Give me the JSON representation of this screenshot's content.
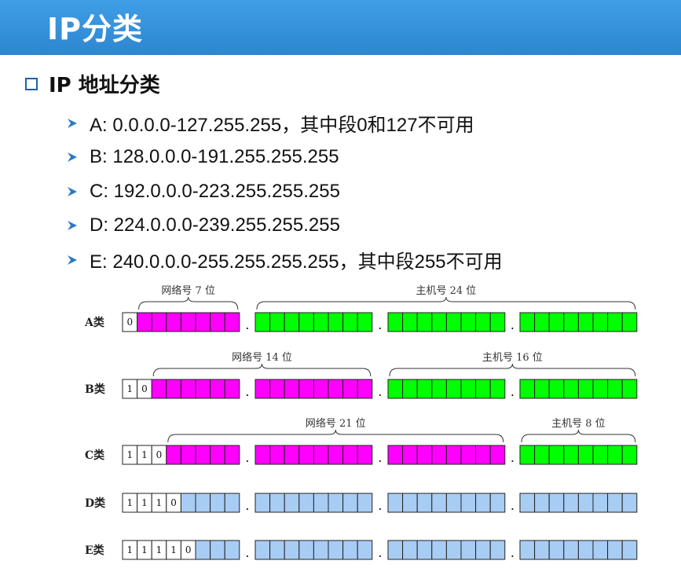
{
  "title": "IP分类",
  "section": {
    "heading": "IP 地址分类"
  },
  "bullets": [
    "A: 0.0.0.0-127.255.255，其中段0和127不可用",
    "B: 128.0.0.0-191.255.255.255",
    "C: 192.0.0.0-223.255.255.255",
    "D: 224.0.0.0-239.255.255.255",
    "E: 240.0.0.0-255.255.255.255，其中段255不可用"
  ],
  "colors": {
    "title_bar": "#3390dd",
    "network": "#ff00ff",
    "host": "#00ff00",
    "class_de": "#a8cdf5",
    "prefix": "#ffffff",
    "bullet_arrow": "#2a78c8"
  },
  "icons": {
    "heading": "checkbox-icon",
    "bullet": "arrow-icon"
  },
  "diagram": {
    "dot": ".",
    "classes": [
      {
        "label": "A类",
        "prefix": [
          "0"
        ],
        "network_bits": 8,
        "braces": [
          {
            "text": "网络号 7 位",
            "from_bit": 1,
            "to_bit": 8
          },
          {
            "text": "主机号 24 位",
            "from_bit": 8,
            "to_bit": 32
          }
        ]
      },
      {
        "label": "B类",
        "prefix": [
          "1",
          "0"
        ],
        "network_bits": 16,
        "braces": [
          {
            "text": "网络号 14 位",
            "from_bit": 2,
            "to_bit": 16
          },
          {
            "text": "主机号 16 位",
            "from_bit": 16,
            "to_bit": 32
          }
        ]
      },
      {
        "label": "C类",
        "prefix": [
          "1",
          "1",
          "0"
        ],
        "network_bits": 24,
        "braces": [
          {
            "text": "网络号 21 位",
            "from_bit": 3,
            "to_bit": 24
          },
          {
            "text": "主机号 8 位",
            "from_bit": 24,
            "to_bit": 32
          }
        ]
      },
      {
        "label": "D类",
        "prefix": [
          "1",
          "1",
          "1",
          "0"
        ],
        "network_bits": 0,
        "braces": []
      },
      {
        "label": "E类",
        "prefix": [
          "1",
          "1",
          "1",
          "1",
          "0"
        ],
        "network_bits": 0,
        "braces": []
      }
    ]
  }
}
